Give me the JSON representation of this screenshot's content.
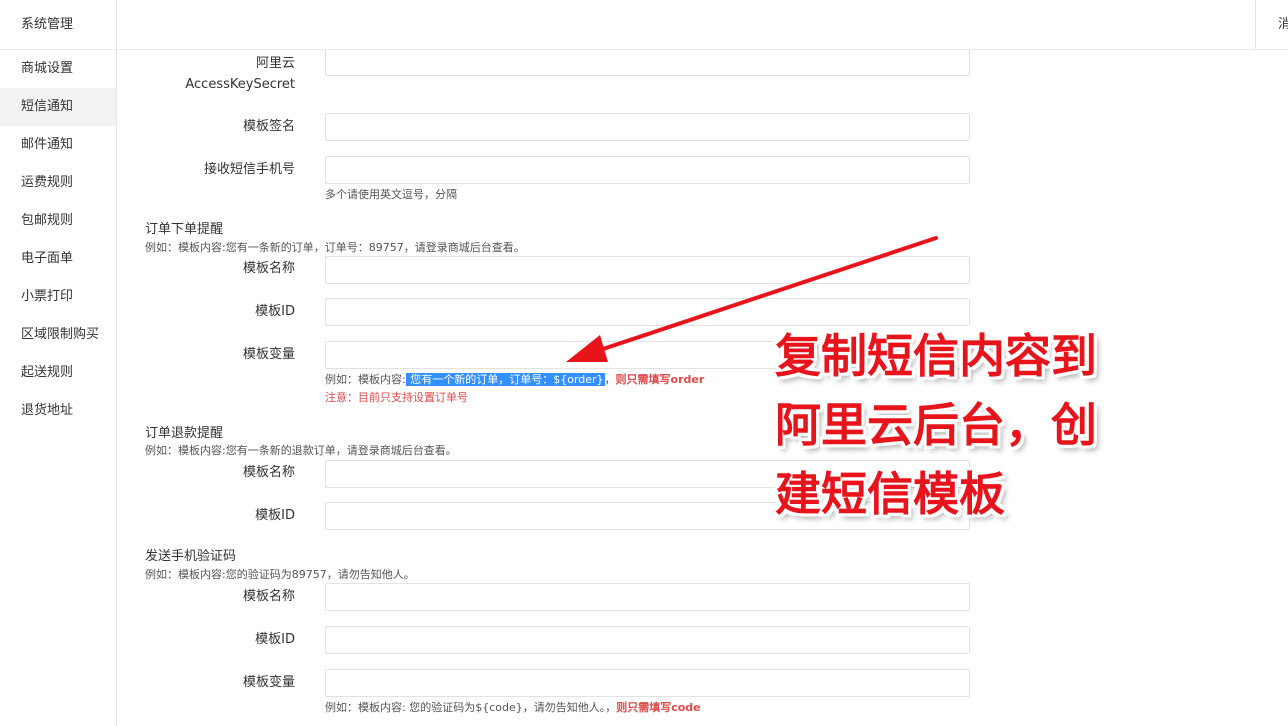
{
  "sidebar": {
    "title": "系统管理",
    "items": [
      {
        "label": "商城设置"
      },
      {
        "label": "短信通知"
      },
      {
        "label": "邮件通知"
      },
      {
        "label": "运费规则"
      },
      {
        "label": "包邮规则"
      },
      {
        "label": "电子面单"
      },
      {
        "label": "小票打印"
      },
      {
        "label": "区域限制购买"
      },
      {
        "label": "起送规则"
      },
      {
        "label": "退货地址"
      }
    ]
  },
  "topbar": {
    "right_text": "消"
  },
  "form": {
    "access_key_secret_label_line1": "阿里云",
    "access_key_secret_label_line2": "AccessKeySecret",
    "template_sign_label": "模板签名",
    "receive_phone_label": "接收短信手机号",
    "receive_phone_hint": "多个请使用英文逗号，分隔",
    "order_section": {
      "title": "订单下单提醒",
      "example": "例如：模板内容:您有一条新的订单，订单号：89757，请登录商城后台查看。",
      "name_label": "模板名称",
      "id_label": "模板ID",
      "var_label": "模板变量",
      "hint_prefix": "例如：模板内容:",
      "hint_highlight": " 您有一个新的订单，订单号：${order}",
      "hint_middle": "，",
      "hint_red": "则只需填写order",
      "note": "注意：目前只支持设置订单号"
    },
    "refund_section": {
      "title": "订单退款提醒",
      "example": "例如：模板内容:您有一条新的退款订单，请登录商城后台查看。",
      "name_label": "模板名称",
      "id_label": "模板ID"
    },
    "code_section": {
      "title": "发送手机验证码",
      "example": "例如：模板内容:您的验证码为89757，请勿告知他人。",
      "name_label": "模板名称",
      "id_label": "模板ID",
      "var_label": "模板变量",
      "hint_prefix": "例如：模板内容: 您的验证码为${code}，请勿告知他人。，",
      "hint_red": "则只需填写code"
    }
  },
  "annotation": {
    "line1": "复制短信内容到",
    "line2": "阿里云后台，创",
    "line3": "建短信模板",
    "color": "#e8141b"
  }
}
